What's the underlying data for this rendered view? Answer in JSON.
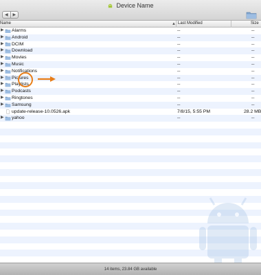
{
  "window": {
    "title": "Device Name"
  },
  "toolbar": {
    "back_glyph": "◀",
    "forward_glyph": "▶"
  },
  "columns": {
    "name": "Name",
    "modified": "Last Modified",
    "size": "Size"
  },
  "files": [
    {
      "name": "Alarms",
      "type": "folder",
      "modified": "--",
      "size": "--"
    },
    {
      "name": "Android",
      "type": "folder",
      "modified": "--",
      "size": "--"
    },
    {
      "name": "DCIM",
      "type": "folder",
      "modified": "--",
      "size": "--"
    },
    {
      "name": "Download",
      "type": "folder",
      "modified": "--",
      "size": "--"
    },
    {
      "name": "Movies",
      "type": "folder",
      "modified": "--",
      "size": "--"
    },
    {
      "name": "Music",
      "type": "folder",
      "modified": "--",
      "size": "--"
    },
    {
      "name": "Notifications",
      "type": "folder",
      "modified": "--",
      "size": "--"
    },
    {
      "name": "Pictures",
      "type": "folder",
      "modified": "--",
      "size": "--"
    },
    {
      "name": "Playlists",
      "type": "folder",
      "modified": "--",
      "size": "--"
    },
    {
      "name": "Podcasts",
      "type": "folder",
      "modified": "--",
      "size": "--"
    },
    {
      "name": "Ringtones",
      "type": "folder",
      "modified": "--",
      "size": "--"
    },
    {
      "name": "Samsung",
      "type": "folder",
      "modified": "--",
      "size": "--"
    },
    {
      "name": "update-release-10.0526.apk",
      "type": "file",
      "modified": "7/8/15, 5:55 PM",
      "size": "28.2 MB"
    },
    {
      "name": "yahoo",
      "type": "folder",
      "modified": "--",
      "size": "--"
    }
  ],
  "status": {
    "text": "14 items, 23.84 GB available"
  },
  "colors": {
    "accent": "#e87d17",
    "stripe": "#edf3fe",
    "folder": "#8fb0d6"
  },
  "icons": {
    "expand": "▶"
  }
}
